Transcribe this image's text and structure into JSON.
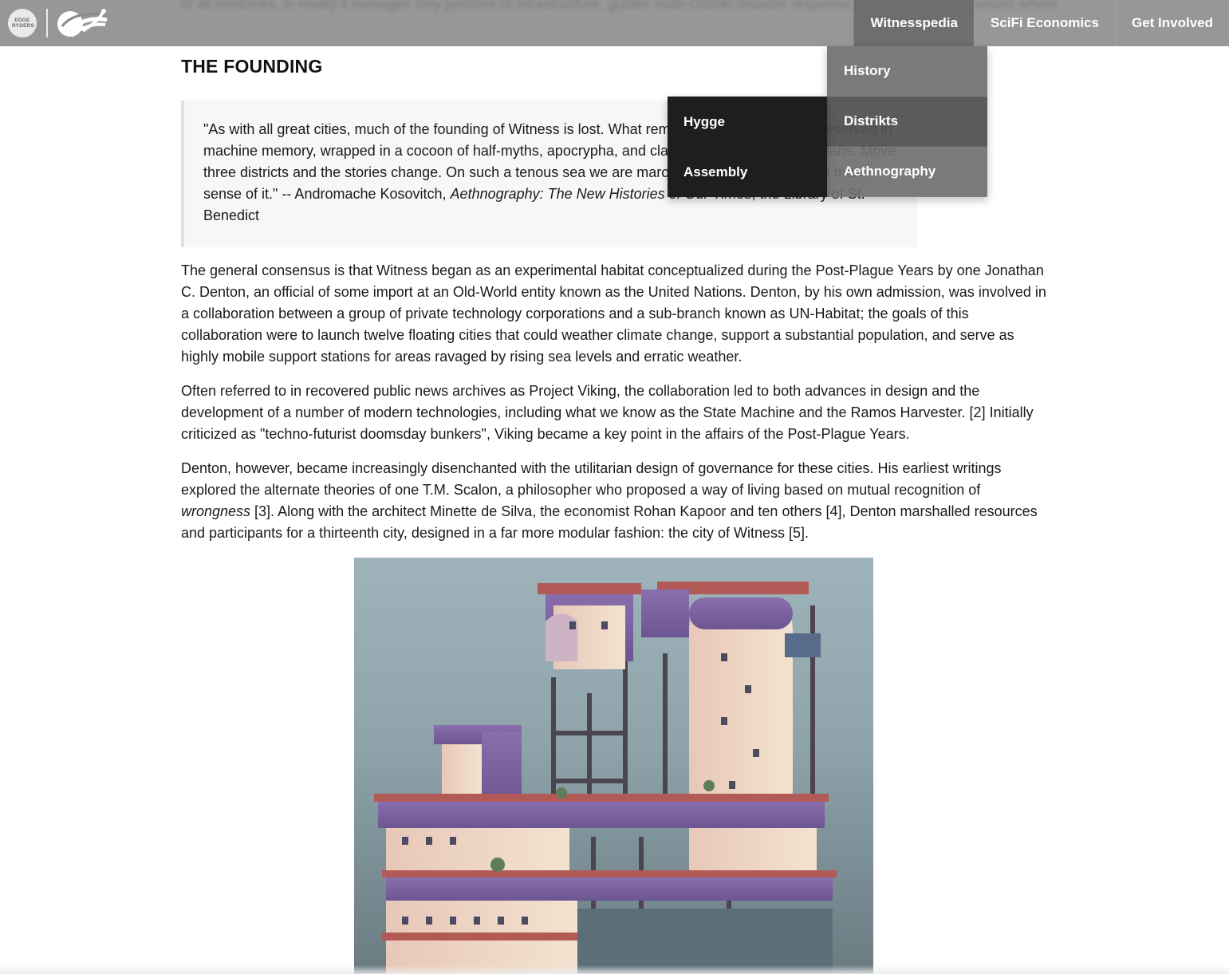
{
  "navbar": {
    "items": [
      {
        "label": "Witnesspedia",
        "active": true
      },
      {
        "label": "SciFi Economics",
        "active": false
      },
      {
        "label": "Get Involved",
        "active": false
      }
    ],
    "behind_text": "of all territories, in reality it manages only portions of infrastructure, guides multi-Distrikt disaster response, and policing in instances where inter-Distrikt conflict seems imminent.",
    "logo_text": "EDGE RYDERS"
  },
  "dropdown": {
    "items": [
      {
        "label": "History"
      },
      {
        "label": "Distrikts"
      },
      {
        "label": "Aethnography"
      }
    ]
  },
  "subdropdown": {
    "items": [
      {
        "label": "Hygge"
      },
      {
        "label": "Assembly"
      }
    ]
  },
  "article": {
    "section_title": "THE FOUNDING",
    "quote": {
      "text_before": "\"As with all great cities, much of the founding of Witness is lost. What remains are skeleton logs preserved in machine memory, wrapped in a cocoon of half-myths, apocrypha, and clashes between rival historians. Move three districts and the stories change. On such a tenous sea we are marooned, and it is up to us to make sense of it.\" -- Andromache Kosovitch, ",
      "italic": "Aethnography: The New Histories of Our Times",
      "text_after": ", the Library of St. Benedict"
    },
    "paragraph_1": "The general consensus is that Witness began as an experimental habitat conceptualized during the Post-Plague Years by one Jonathan C. Denton, an official of some import at an Old-World entity known as the United Nations. Denton, by his own admission, was involved in a collaboration between a group of private technology corporations and a sub-branch known as UN-Habitat; the goals of this collaboration were to launch twelve floating cities that could weather climate change, support a substantial population, and serve as highly mobile support stations for areas ravaged by rising sea levels and erratic weather.",
    "paragraph_2": "Often referred to in recovered public news archives as Project Viking, the collaboration led to both advances in design and the development of a number of modern technologies, including what we know as the State Machine and the Ramos Harvester. [2] Initially criticized as \"techno-futurist doomsday bunkers\", Viking became a key point in the affairs of the Post-Plague Years.",
    "paragraph_3": {
      "before": "Denton, however, became increasingly disenchanted with the utilitarian design of governance for these cities. His earliest writings explored the alternate theories of one T.M. Scalon, a philosopher who proposed a way of living based on mutual recognition of ",
      "italic": "wrongness",
      "after": " [3]. Along with the architect Minette de Silva, the economist Rohan Kapoor and ten others [4], Denton marshalled resources and participants for a thirteenth city, designed in a far more modular fashion: the city of Witness [5]."
    }
  }
}
